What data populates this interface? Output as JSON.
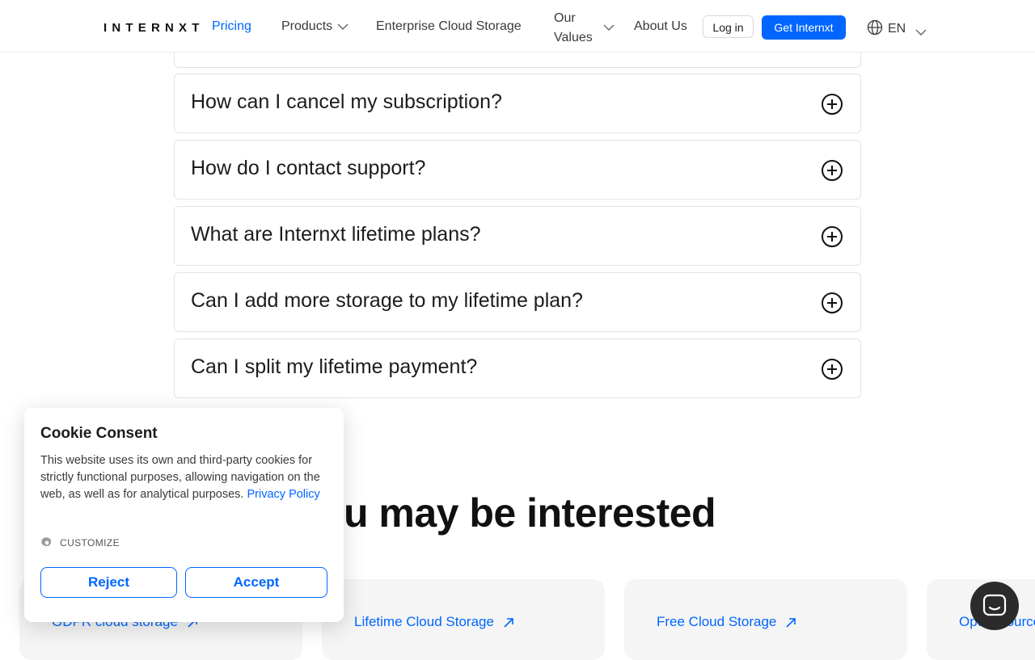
{
  "header": {
    "logo": "INTERNXT",
    "nav": {
      "pricing": "Pricing",
      "products": "Products",
      "enterprise": "Enterprise Cloud Storage",
      "values": "Our Values",
      "about": "About Us"
    },
    "login": "Log in",
    "get_internxt": "Get Internxt",
    "language": "EN"
  },
  "faq": [
    {
      "question": "How can I cancel my subscription?"
    },
    {
      "question": "How do I contact support?"
    },
    {
      "question": "What are Internxt lifetime plans?"
    },
    {
      "question": "Can I add more storage to my lifetime plan?"
    },
    {
      "question": "Can I split my lifetime payment?"
    }
  ],
  "section": {
    "title": "ou may be interested"
  },
  "cards": [
    {
      "label": "GDPR cloud storage"
    },
    {
      "label": "Lifetime Cloud Storage"
    },
    {
      "label": "Free Cloud Storage"
    },
    {
      "label": "Open-Source"
    }
  ],
  "cookie": {
    "title": "Cookie Consent",
    "text": "This website uses its own and third-party cookies for strictly functional purposes, allowing navigation on the web, as well as for analytical purposes.",
    "privacy_link": "Privacy Policy",
    "customize": "CUSTOMIZE",
    "reject": "Reject",
    "accept": "Accept"
  },
  "colors": {
    "accent": "#0066ff",
    "chat": "#2b2b2b"
  },
  "icons": {
    "faq_expand": "plus-circle-icon",
    "card_link": "arrow-up-right-icon",
    "language": "globe-icon",
    "customize": "gear-icon",
    "chat": "chat-icon"
  }
}
